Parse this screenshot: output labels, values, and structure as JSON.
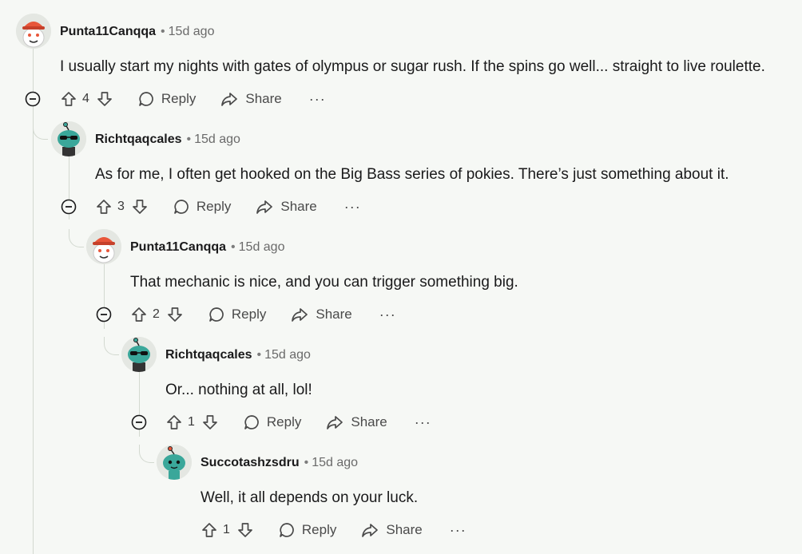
{
  "comments": [
    {
      "author": "Punta11Canqqa",
      "time": "15d ago",
      "text": "I usually start my nights with gates of olympus or sugar rush. If the spins go well... straight to live roulette.",
      "votes": "4",
      "reply_label": "Reply",
      "share_label": "Share",
      "more_label": "···",
      "avatar": "snoo-red-cap"
    },
    {
      "author": "Richtqaqcales",
      "time": "15d ago",
      "text": "As for me, I often get hooked on the Big Bass series of pokies. There’s just something about it.",
      "votes": "3",
      "reply_label": "Reply",
      "share_label": "Share",
      "more_label": "···",
      "avatar": "snoo-teal-sunglasses"
    },
    {
      "author": "Punta11Canqqa",
      "time": "15d ago",
      "text": "That mechanic is nice, and you can trigger something big.",
      "votes": "2",
      "reply_label": "Reply",
      "share_label": "Share",
      "more_label": "···",
      "avatar": "snoo-red-cap"
    },
    {
      "author": "Richtqaqcales",
      "time": "15d ago",
      "text": "Or... nothing at all, lol!",
      "votes": "1",
      "reply_label": "Reply",
      "share_label": "Share",
      "more_label": "···",
      "avatar": "snoo-teal-sunglasses"
    },
    {
      "author": "Succotashzsdru",
      "time": "15d ago",
      "text": "Well, it all depends on your luck.",
      "votes": "1",
      "reply_label": "Reply",
      "share_label": "Share",
      "more_label": "···",
      "avatar": "snoo-teal"
    }
  ],
  "meta_separator": "•",
  "colors": {
    "background": "#f6f8f5",
    "thread_line": "#d3d9d0",
    "snoo_red": "#e8563a",
    "snoo_teal": "#3aa79a"
  }
}
